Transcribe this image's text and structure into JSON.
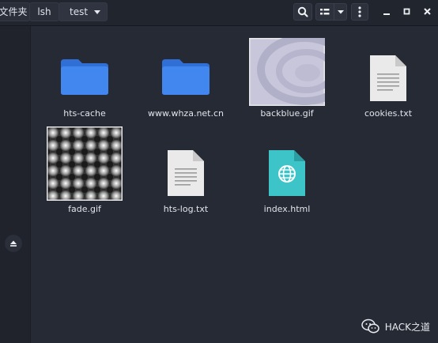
{
  "header": {
    "breadcrumbs": [
      "文件夹",
      "lsh",
      "test"
    ],
    "active_crumb": "test"
  },
  "toolbar": {
    "search_icon": "search-icon",
    "view_icon": "list-view-icon",
    "view_dropdown_icon": "chevron-down-icon",
    "menu_icon": "kebab-menu-icon"
  },
  "window_controls": [
    "minimize-icon",
    "maximize-icon",
    "close-icon"
  ],
  "sidebar": {
    "eject_icon": "eject-icon"
  },
  "files": [
    {
      "name": "hts-cache",
      "type": "folder"
    },
    {
      "name": "www.whza.net.cn",
      "type": "folder"
    },
    {
      "name": "backblue.gif",
      "type": "image"
    },
    {
      "name": "cookies.txt",
      "type": "text"
    },
    {
      "name": "fade.gif",
      "type": "image"
    },
    {
      "name": "hts-log.txt",
      "type": "text"
    },
    {
      "name": "index.html",
      "type": "html"
    }
  ],
  "watermark": {
    "text": "HACK之道"
  },
  "colors": {
    "background": "#262a35",
    "folder": "#3d7ee6",
    "html_icon": "#35c0c4",
    "selection_border": "#e8e8e8"
  }
}
